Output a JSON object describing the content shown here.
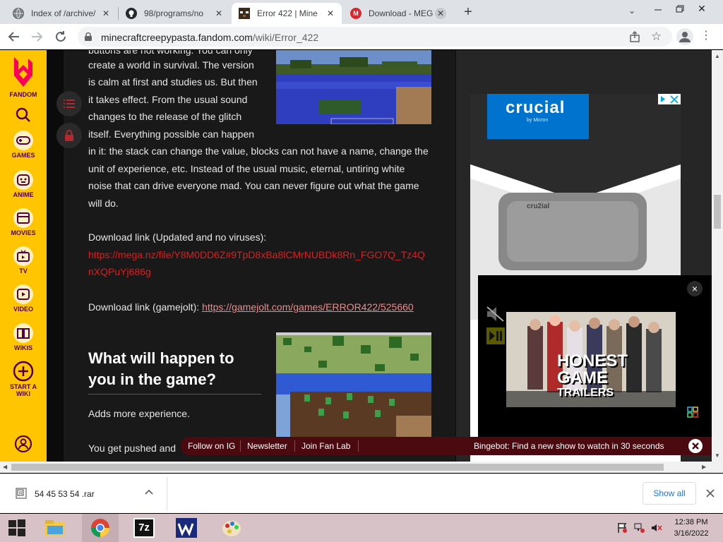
{
  "browser": {
    "tabs": [
      {
        "label": "Index of /archive/",
        "favicon": "globe-icon"
      },
      {
        "label": "98/programs/no",
        "favicon": "github-icon"
      },
      {
        "label": "Error 422 | Mine",
        "favicon": "minecraft-icon"
      },
      {
        "label": "Download - MEG",
        "favicon": "mega-icon"
      }
    ],
    "new_tab": "+",
    "url_host": "minecraftcreepypasta.fandom.com",
    "url_path": "/wiki/Error_422"
  },
  "rail": {
    "logo_label": "FANDOM",
    "items": [
      {
        "label": "GAMES",
        "icon": "gamepad-icon"
      },
      {
        "label": "ANIME",
        "icon": "anime-icon"
      },
      {
        "label": "MOVIES",
        "icon": "movies-icon"
      },
      {
        "label": "TV",
        "icon": "tv-icon"
      },
      {
        "label": "VIDEO",
        "icon": "video-icon"
      },
      {
        "label": "WIKIS",
        "icon": "wikis-icon"
      }
    ],
    "start_wiki_line1": "START A",
    "start_wiki_line2": "WIKI"
  },
  "article": {
    "top_fragment": "buttons are not working. You can only",
    "para1_lines": [
      "create a world in survival. The version",
      "is calm at first and studies us. But then",
      "it takes effect. From the usual sound",
      "changes to the release of the glitch",
      "itself. Everything possible can happen",
      "in it: the stack can change the value, blocks can not have a name, change the",
      "unit of experience, etc. Instead of the usual music, eternal, untiring white",
      "noise that can drive everyone mad. You can never figure out what the game",
      "will do."
    ],
    "download_label_1": "Download link (Updated and no viruses):",
    "mega_link_line1": "https://mega.nz/file/Y8M0DD6Z#9TpD8xBa8lCMrNUBDk8Rn_FGO7Q_Tz4Q",
    "mega_link_line2": "nXQPuYj686g",
    "download_label_2": "Download link (gamejolt): ",
    "gamejolt_link": "https://gamejolt.com/games/ERROR422/525660",
    "heading_line1": "What will happen to",
    "heading_line2": "you in the game?",
    "para2": "Adds more experience.",
    "para3": "You get pushed and"
  },
  "ad": {
    "brand": "crucial",
    "brand_sub": "by Micron",
    "ssd_label": "cru2ial"
  },
  "video_ad": {
    "close": "×",
    "line1": "HONEST",
    "line2": "GAME",
    "line3": "TRAILERS"
  },
  "bottom_bar": {
    "links": [
      "Follow on IG",
      "Newsletter",
      "Join Fan Lab"
    ],
    "bingebot": "Bingebot: Find a new show to watch in 30 seconds"
  },
  "downloads": {
    "file_name": "54 45 53 54 .rar",
    "show_all": "Show all"
  },
  "taskbar": {
    "time": "12:38 PM",
    "date": "3/16/2022",
    "sevenzip": "7z"
  },
  "colors": {
    "fandom_yellow": "#ffc500",
    "fandom_purple": "#520044",
    "link_red": "#e31c1c",
    "bottom_bar": "#4a0a10"
  }
}
